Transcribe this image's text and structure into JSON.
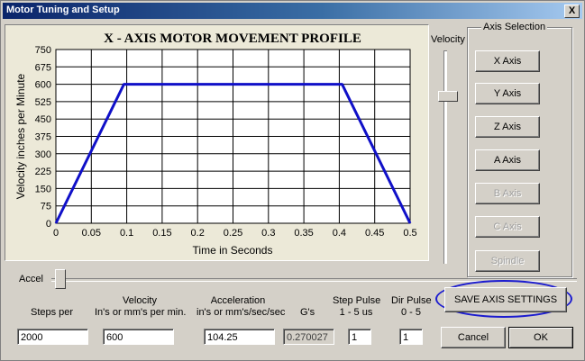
{
  "window": {
    "title": "Motor Tuning and Setup",
    "close_glyph": "X"
  },
  "chart_data": {
    "type": "line",
    "title": "X - AXIS MOTOR MOVEMENT PROFILE",
    "xlabel": "Time in Seconds",
    "ylabel": "Velocity inches per Minute",
    "xlim": [
      0,
      0.5
    ],
    "ylim": [
      0,
      750
    ],
    "xticks": [
      "0",
      "0.05",
      "0.1",
      "0.15",
      "0.2",
      "0.25",
      "0.3",
      "0.35",
      "0.4",
      "0.45",
      "0.5"
    ],
    "yticks": [
      "0",
      "75",
      "150",
      "225",
      "300",
      "375",
      "450",
      "525",
      "600",
      "675",
      "750"
    ],
    "grid": true,
    "series": [
      {
        "x": [
          0,
          0.096,
          0.404,
          0.5
        ],
        "y": [
          0,
          600,
          600,
          0
        ],
        "color": "#1010c8"
      }
    ]
  },
  "velocity_slider": {
    "label": "Velocity"
  },
  "axis_selection": {
    "title": "Axis Selection",
    "buttons": [
      {
        "label": "X Axis",
        "enabled": true
      },
      {
        "label": "Y Axis",
        "enabled": true
      },
      {
        "label": "Z Axis",
        "enabled": true
      },
      {
        "label": "A Axis",
        "enabled": true
      },
      {
        "label": "B Axis",
        "enabled": false
      },
      {
        "label": "C Axis",
        "enabled": false
      },
      {
        "label": "Spindle",
        "enabled": false
      }
    ]
  },
  "accel_slider": {
    "label": "Accel"
  },
  "fields": {
    "steps_per": {
      "label": "Steps per",
      "value": "2000"
    },
    "velocity": {
      "label1": "Velocity",
      "label2": "In's or mm's per min.",
      "value": "600"
    },
    "acceleration": {
      "label1": "Acceleration",
      "label2": "in's or mm's/sec/sec",
      "value": "104.25"
    },
    "gs": {
      "label": "G's",
      "value": "0.270027"
    },
    "step_pulse": {
      "label1": "Step Pulse",
      "label2": "1 - 5 us",
      "value": "1"
    },
    "dir_pulse": {
      "label1": "Dir Pulse",
      "label2": "0 - 5",
      "value": "1"
    }
  },
  "buttons": {
    "save": "SAVE AXIS SETTINGS",
    "cancel": "Cancel",
    "ok": "OK"
  },
  "colors": {
    "title_bar": "#0a246a",
    "plot_line": "#1010c8",
    "highlight_oval": "#1c1ccf"
  }
}
